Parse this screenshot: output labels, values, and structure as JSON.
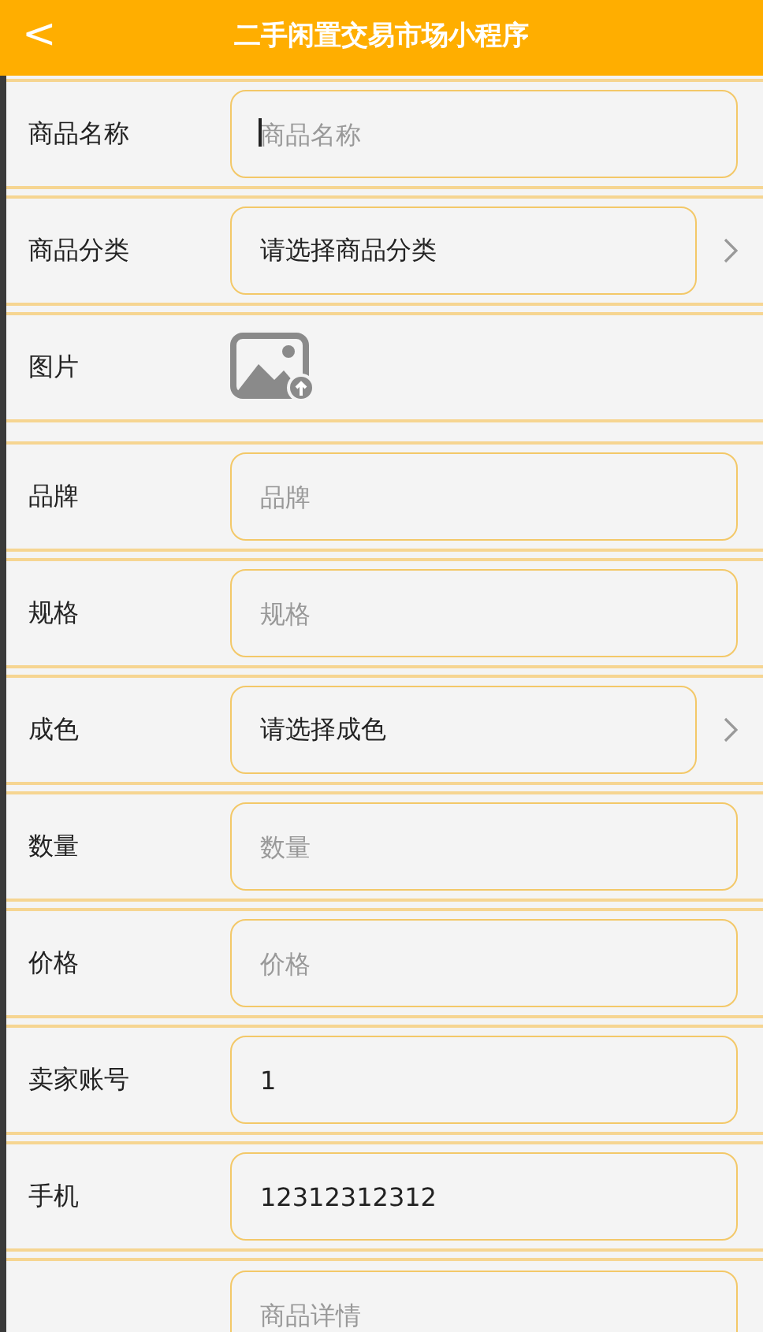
{
  "header": {
    "back": "<",
    "title": "二手闲置交易市场小程序"
  },
  "rows": [
    {
      "kind": "input",
      "label": "商品名称",
      "placeholder": "商品名称",
      "focused": true
    },
    {
      "kind": "select",
      "label": "商品分类",
      "value": "请选择商品分类"
    },
    {
      "kind": "image",
      "label": "图片"
    },
    {
      "kind": "input",
      "label": "品牌",
      "placeholder": "品牌"
    },
    {
      "kind": "input",
      "label": "规格",
      "placeholder": "规格"
    },
    {
      "kind": "select",
      "label": "成色",
      "value": "请选择成色"
    },
    {
      "kind": "input",
      "label": "数量",
      "placeholder": "数量"
    },
    {
      "kind": "input",
      "label": "价格",
      "placeholder": "价格"
    },
    {
      "kind": "input",
      "label": "卖家账号",
      "value": "1"
    },
    {
      "kind": "input",
      "label": "手机",
      "value": "12312312312"
    },
    {
      "kind": "textarea",
      "placeholder": "商品详情"
    }
  ]
}
